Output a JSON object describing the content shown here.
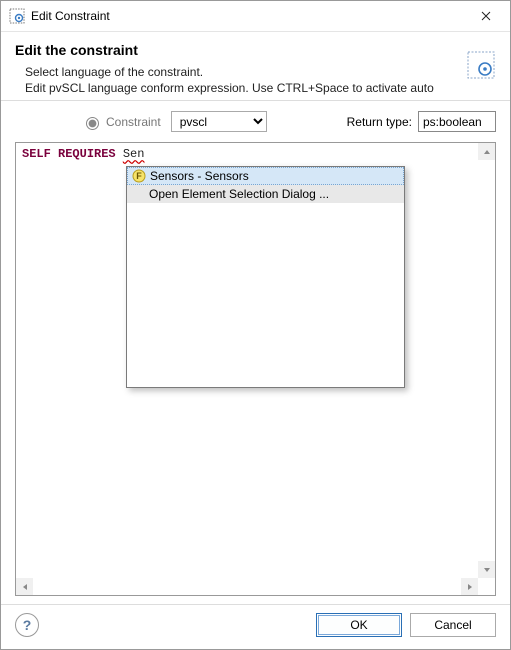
{
  "window": {
    "title": "Edit Constraint"
  },
  "header": {
    "title": "Edit the constraint",
    "line1": "Select language of the constraint.",
    "line2": "Edit pvSCL language conform expression. Use CTRL+Space to activate auto"
  },
  "form": {
    "constraint_label": "Constraint",
    "language_options": [
      "pvscl"
    ],
    "language_value": "pvscl",
    "return_label": "Return type:",
    "return_value": "ps:boolean"
  },
  "editor": {
    "kw1": "SELF",
    "kw2": "REQUIRES",
    "partial": "Sen"
  },
  "autocomplete": {
    "items": [
      {
        "icon": "F",
        "label": "Sensors - Sensors",
        "selected": true
      },
      {
        "icon": "",
        "label": "Open Element Selection Dialog ...",
        "alt": true
      }
    ]
  },
  "buttons": {
    "ok": "OK",
    "cancel": "Cancel"
  }
}
